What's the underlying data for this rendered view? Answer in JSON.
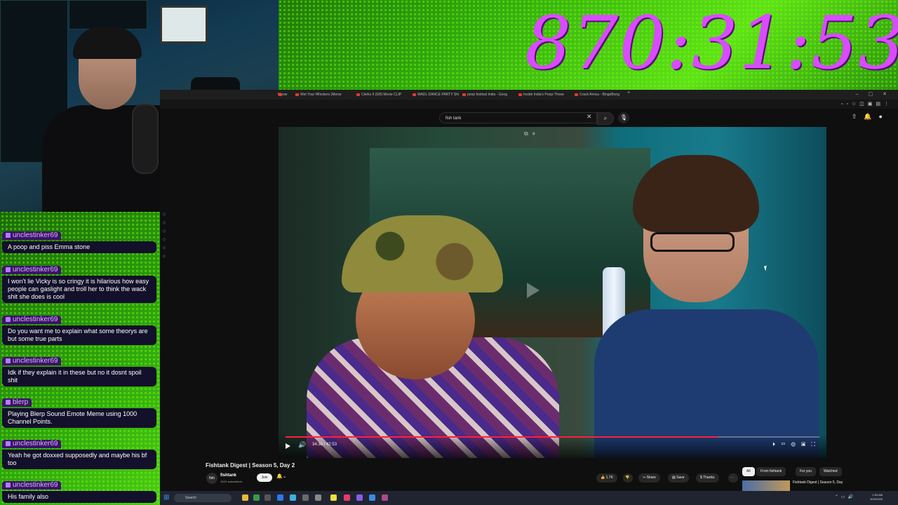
{
  "timer": "870:31:53",
  "chat": {
    "messages": [
      {
        "user": "unclestinker69",
        "text": "A poop and piss Emma stone"
      },
      {
        "user": "unclestinker69",
        "text": "I won't lie Vicky is so cringy it is hilarious how easy people can gaslight and troll her to think the wack shit she does is cool"
      },
      {
        "user": "unclestinker69",
        "text": "Do you want me to explain what some theorys are but some true parts"
      },
      {
        "user": "unclestinker69",
        "text": "Idk if they explain it in these but no it dosnt spoil shit"
      },
      {
        "user": "blerp",
        "text": "Playing Blerp Sound Emote Meme using 1000 Channel Points."
      },
      {
        "user": "unclestinker69",
        "text": "Yeah he got doxxed supposedly and maybe his bf too"
      },
      {
        "user": "unclestinker69",
        "text": "His family also"
      }
    ]
  },
  "browser": {
    "tabs": [
      "Wet Your Whiskers (Meow",
      "Clerks II (5/8) Movie CLIP",
      "WADL DANCE PARTY Shi",
      "poop festival India - Goog",
      "Inside India's Poop-Throw",
      "Crack Amica - BingoBong"
    ],
    "first_tab_partial": "Meow",
    "search_query": "fish tank"
  },
  "video": {
    "time": "34:38 / 42:53",
    "progress": 0.81,
    "title": "Fishtank Digest | Season 5, Day 2",
    "channel": "fishtank",
    "channel_avatar": "fish",
    "subscribers": "151K subscribers",
    "join_label": "Join",
    "likes": "1.7K",
    "share_label": "Share",
    "save_label": "Save",
    "thanks_label": "Thanks"
  },
  "recommendations": {
    "chips": [
      "All",
      "From fishtank",
      "For you",
      "Watched"
    ],
    "first_title": "Fishtank Digest | Season 5, Day"
  },
  "taskbar": {
    "search_placeholder": "Search",
    "time": "1:54 AM",
    "date": "3/29/2026"
  },
  "colors": {
    "timer": "#d94bff",
    "progress": "#ff1f3f",
    "chat_name_bg": "#3a1466",
    "chat_bubble": "#12102a"
  }
}
